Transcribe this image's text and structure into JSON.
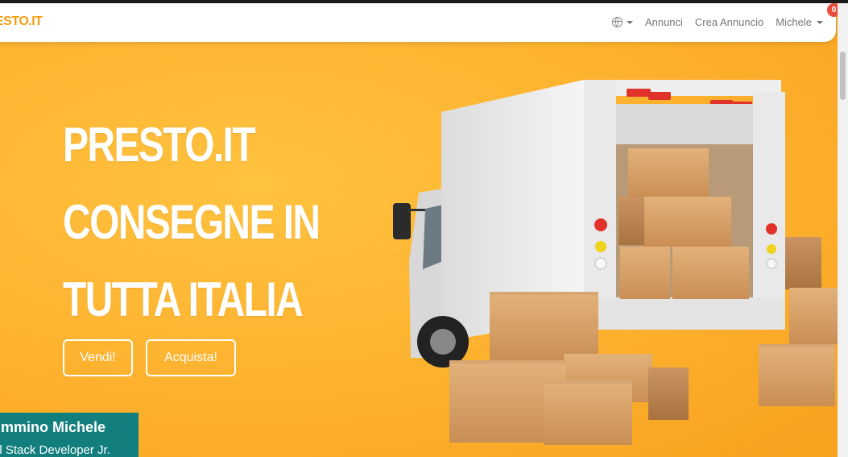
{
  "navbar": {
    "brand": "ESTO.IT",
    "language_icon": "globe-icon",
    "links": [
      "Annunci",
      "Crea Annuncio"
    ],
    "user_name": "Michele",
    "notification_count": "0"
  },
  "hero": {
    "headline": [
      "PRESTO.IT",
      "CONSEGNE IN",
      "TUTTA ITALIA"
    ],
    "buttons": {
      "sell": "Vendi!",
      "buy": "Acquista!"
    },
    "image": "delivery-truck-with-boxes"
  },
  "caption": {
    "name": "immino Michele",
    "role": "ll Stack Developer Jr."
  },
  "colors": {
    "background": "#fdb12e",
    "brand": "#f39c12",
    "badge": "#e74c3c",
    "caption_bg": "#127f7e"
  }
}
